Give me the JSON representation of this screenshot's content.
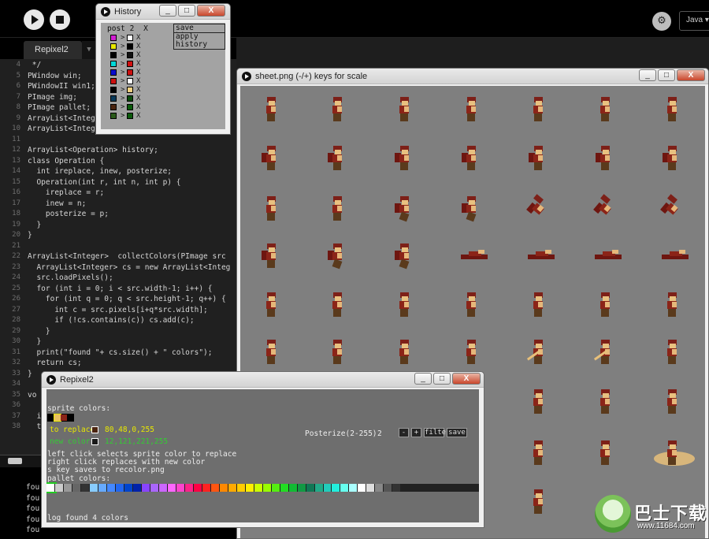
{
  "ide": {
    "tab_label": "Repixel2",
    "mode_label": "Java ▾",
    "debug_icon_glyph": "⚙",
    "colors": {
      "keyword": "#cc6633",
      "type": "#e2661a",
      "method": "#33997e",
      "string": "#7d4793",
      "plain": "#d5d5d5"
    }
  },
  "code_lines": [
    {
      "n": "4",
      "text": " */"
    },
    {
      "n": "5",
      "text": "PWindow win;"
    },
    {
      "n": "6",
      "text": "PWindowII win1;"
    },
    {
      "n": "7",
      "text": "PImage img;"
    },
    {
      "n": "8",
      "text": "PImage pallet;"
    },
    {
      "n": "9",
      "text": "ArrayList<Integer"
    },
    {
      "n": "10",
      "text": "ArrayList<Integer"
    },
    {
      "n": "11",
      "text": ""
    },
    {
      "n": "12",
      "text": "ArrayList<Operation> history;"
    },
    {
      "n": "13",
      "text": "class Operation {"
    },
    {
      "n": "14",
      "text": "  int ireplace, inew, posterize;"
    },
    {
      "n": "15",
      "text": "  Operation(int r, int n, int p) {"
    },
    {
      "n": "16",
      "text": "    ireplace = r;"
    },
    {
      "n": "17",
      "text": "    inew = n;"
    },
    {
      "n": "18",
      "text": "    posterize = p;"
    },
    {
      "n": "19",
      "text": "  }"
    },
    {
      "n": "20",
      "text": "}"
    },
    {
      "n": "21",
      "text": ""
    },
    {
      "n": "22",
      "text": "ArrayList<Integer>  collectColors(PImage src"
    },
    {
      "n": "23",
      "text": "  ArrayList<Integer> cs = new ArrayList<Integ"
    },
    {
      "n": "24",
      "text": "  src.loadPixels();"
    },
    {
      "n": "25",
      "text": "  for (int i = 0; i < src.width-1; i++) {"
    },
    {
      "n": "26",
      "text": "    for (int q = 0; q < src.height-1; q++) {"
    },
    {
      "n": "27",
      "text": "      int c = src.pixels[i+q*src.width];"
    },
    {
      "n": "28",
      "text": "      if (!cs.contains(c)) cs.add(c);"
    },
    {
      "n": "29",
      "text": "    }"
    },
    {
      "n": "30",
      "text": "  }"
    },
    {
      "n": "31",
      "text": "  print(\"found \"+ cs.size() + \" colors\");"
    },
    {
      "n": "32",
      "text": "  return cs;"
    },
    {
      "n": "33",
      "text": "}"
    },
    {
      "n": "34",
      "text": ""
    },
    {
      "n": "35",
      "text": "vo"
    },
    {
      "n": "36",
      "text": ""
    },
    {
      "n": "37",
      "text": "  i"
    },
    {
      "n": "38",
      "text": "  t"
    }
  ],
  "console_lines": [
    "fou",
    "fou",
    "fou",
    "fou",
    "fou"
  ],
  "history_window": {
    "title": "History",
    "min": "_",
    "max": "□",
    "close": "X",
    "first_row_label": "post 2",
    "first_row_x": "X",
    "save_button": "save history",
    "apply_button": "apply history",
    "arrow": ">",
    "x": "X",
    "rows": [
      {
        "from": "#d21ed2",
        "to": "#ffffff"
      },
      {
        "from": "#e8e800",
        "to": "#000000"
      },
      {
        "from": "#000000",
        "to": "#111111"
      },
      {
        "from": "#00d8d8",
        "to": "#d01010"
      },
      {
        "from": "#0a0acc",
        "to": "#cc1010"
      },
      {
        "from": "#cc1010",
        "to": "#ffffff"
      },
      {
        "from": "#000000",
        "to": "#f0d080"
      },
      {
        "from": "#0a3a5a",
        "to": "#0a4a0a"
      },
      {
        "from": "#4a2410",
        "to": "#0a5a0a"
      },
      {
        "from": "#2a5a1a",
        "to": "#0a5a0a"
      }
    ]
  },
  "sheet_window": {
    "title": "sheet.png (-/+) keys for scale",
    "min": "_",
    "max": "□",
    "close": "X"
  },
  "sprite_rows": [
    [
      "stand",
      "stand",
      "stand",
      "stand",
      "stand",
      "stand",
      "stand"
    ],
    [
      "walk",
      "walk",
      "walk",
      "walk",
      "walk",
      "walk",
      "walk"
    ],
    [
      "stand",
      "stand",
      "jump",
      "jump",
      "curl",
      "curl",
      "curl"
    ],
    [
      "cape",
      "jump",
      "jump",
      "flat",
      "flat",
      "flat",
      "flat"
    ],
    [
      "stand",
      "stand",
      "stand",
      "stand",
      "stand",
      "stand",
      "stand"
    ],
    [
      "stand",
      "stand",
      "stand",
      "stand",
      "sword",
      "sword",
      "stand"
    ],
    [
      "none",
      "none",
      "none",
      "none",
      "stand",
      "stand",
      "stand"
    ],
    [
      "none",
      "none",
      "none",
      "none",
      "stand",
      "stand",
      "slash"
    ],
    [
      "none",
      "none",
      "none",
      "none",
      "stand",
      "none",
      "none"
    ]
  ],
  "repixel_window": {
    "title": "Repixel2",
    "min": "_",
    "max": "□",
    "close": "X",
    "sprite_colors_label": "sprite colors:",
    "to_replace_label": "to replace",
    "to_replace_color": "#4a2410",
    "to_replace_value": "80,48,0,255",
    "new_color_label": "new color",
    "new_color_color": "#1a1a1a",
    "new_color_value": "12,121,221,255",
    "posterize_label": "Posterize(2-255)",
    "posterize_value": "2",
    "minus_button": "-",
    "plus_button": "+",
    "filter_button": "filter",
    "save_button": "save",
    "help_1": "left click selects sprite color to replace",
    "help_2": "right click replaces with new color",
    "help_3": "s key saves to recolor.png",
    "pallet_colors_label": "pallet colors:",
    "log_text": "log found 4 colors",
    "sprite_swatches": [
      "#000000",
      "#e8c060",
      "#8b2418",
      "#000000"
    ],
    "palette": [
      "#ffffff",
      "#cccccc",
      "#999999",
      "#666666",
      "#333333",
      "#88ccff",
      "#66aaff",
      "#4488ff",
      "#2266ee",
      "#0044cc",
      "#0022aa",
      "#8844ff",
      "#aa66ff",
      "#cc66ff",
      "#ff66ff",
      "#ff44cc",
      "#ff2288",
      "#ff0044",
      "#ff2222",
      "#ff5511",
      "#ff8800",
      "#ffaa00",
      "#ffcc00",
      "#ffee00",
      "#ccff00",
      "#99ff00",
      "#55ee11",
      "#22dd22",
      "#11bb33",
      "#119944",
      "#117755",
      "#22aa88",
      "#22ccbb",
      "#22eedd",
      "#66ffee",
      "#aaffff",
      "#ffffff",
      "#dddddd",
      "#888888",
      "#555555",
      "#333333",
      "#222222",
      "#222222",
      "#222222",
      "#222222",
      "#222222",
      "#222222",
      "#222222",
      "#222222",
      "#222222"
    ]
  },
  "watermark": {
    "text": "巴士下载",
    "url": "www.11684.com"
  }
}
